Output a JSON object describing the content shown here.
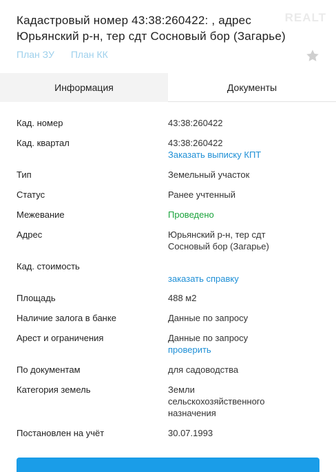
{
  "header": {
    "title": "Кадастровый номер 43:38:260422:     , адрес Юрьянский р-н, тер сдт Сосновый бор (Загарье)",
    "watermark": "REALT",
    "plan_zu": "План ЗУ",
    "plan_kk": "План КК"
  },
  "tabs": [
    "Информация",
    "Документы"
  ],
  "rows": {
    "kad_nomer": {
      "label": "Кад. номер",
      "value": "43:38:260422"
    },
    "kad_kvartal": {
      "label": "Кад. квартал",
      "value": "43:38:260422",
      "link": "Заказать выписку КПТ"
    },
    "tip": {
      "label": "Тип",
      "value": "Земельный участок"
    },
    "status": {
      "label": "Статус",
      "value": "Ранее учтенный"
    },
    "mezhevanie": {
      "label": "Межевание",
      "value": "Проведено"
    },
    "adres": {
      "label": "Адрес",
      "line1": "Юрьянский р-н, тер сдт",
      "line2": "Сосновый бор (Загарье)"
    },
    "stoimost": {
      "label": "Кад. стоимость",
      "link": "заказать справку"
    },
    "ploshchad": {
      "label": "Площадь",
      "value": "488 м2"
    },
    "zalog": {
      "label": "Наличие залога в банке",
      "value": "Данные по запросу"
    },
    "arest": {
      "label": "Арест и ограничения",
      "value": "Данные по запросу",
      "link": "проверить"
    },
    "po_dokumentam": {
      "label": "По документам",
      "value": "для садоводства"
    },
    "kategoriya": {
      "label": "Категория земель",
      "line1": "Земли",
      "line2": "сельскохозяйственного",
      "line3": "назначения"
    },
    "postanovlen": {
      "label": "Постановлен на учёт",
      "value": "30.07.1993"
    }
  },
  "colors": {
    "link": "#1e8fd6",
    "plan_link": "#9ed0ec",
    "green": "#1aa33c",
    "button": "#1a9de8"
  }
}
